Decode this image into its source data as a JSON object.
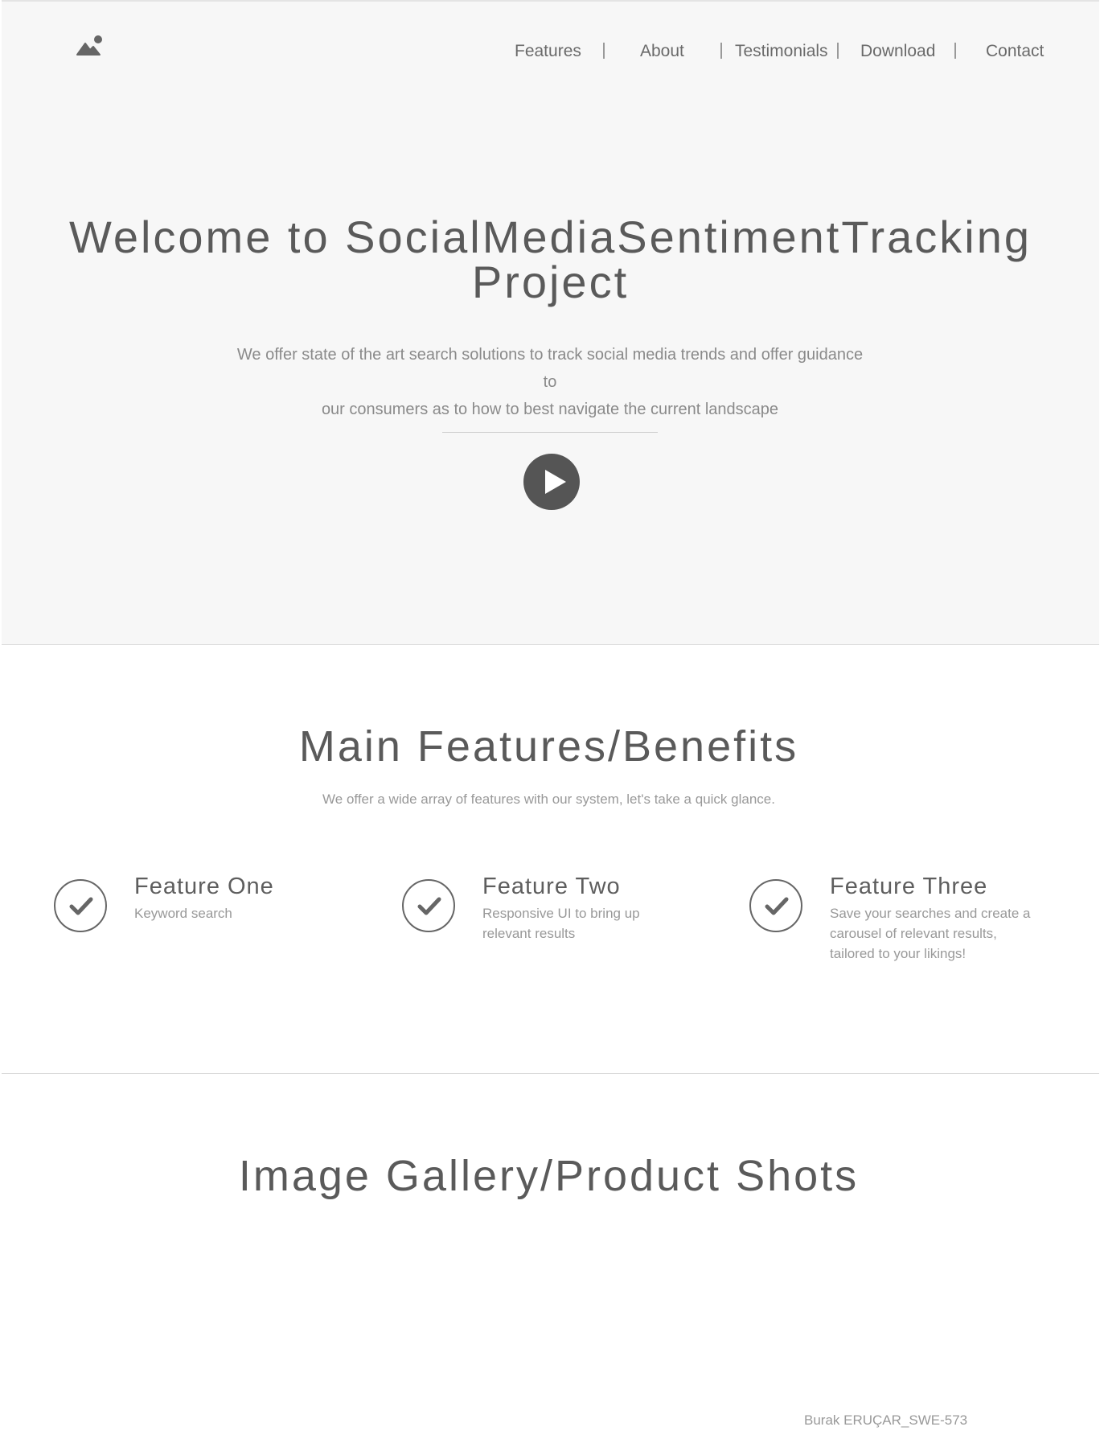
{
  "nav": {
    "items": [
      {
        "label": "Features"
      },
      {
        "label": "About"
      },
      {
        "label": "Testimonials"
      },
      {
        "label": "Download"
      },
      {
        "label": "Contact"
      }
    ],
    "separator_color": "#9a9a9a"
  },
  "hero": {
    "title_line1": "Welcome to SocialMediaSentimentTracking",
    "title_line2": "Project",
    "description_line1": "We offer state of the art search solutions to track social media trends and offer guidance to",
    "description_line2": "our consumers as to how to best navigate the current landscape",
    "play_icon": "play-icon",
    "background": "#f7f7f7"
  },
  "features_section": {
    "title": "Main Features/Benefits",
    "subtitle": "We offer a wide array of  features with our system, let's take a quick glance.",
    "items": [
      {
        "title": "Feature One",
        "description": "Keyword search",
        "icon": "check-icon"
      },
      {
        "title": "Feature Two",
        "description": "Responsive UI to bring up relevant results",
        "icon": "check-icon"
      },
      {
        "title": "Feature Three",
        "description": "Save your searches and create a carousel of relevant results, tailored to your likings!",
        "icon": "check-icon"
      }
    ]
  },
  "gallery_section": {
    "title": "Image Gallery/Product Shots"
  },
  "footer": {
    "credit": "Burak ERUÇAR_SWE-573"
  },
  "colors": {
    "text_dark": "#5a5a5a",
    "text_muted": "#999999",
    "icon": "#666666"
  }
}
